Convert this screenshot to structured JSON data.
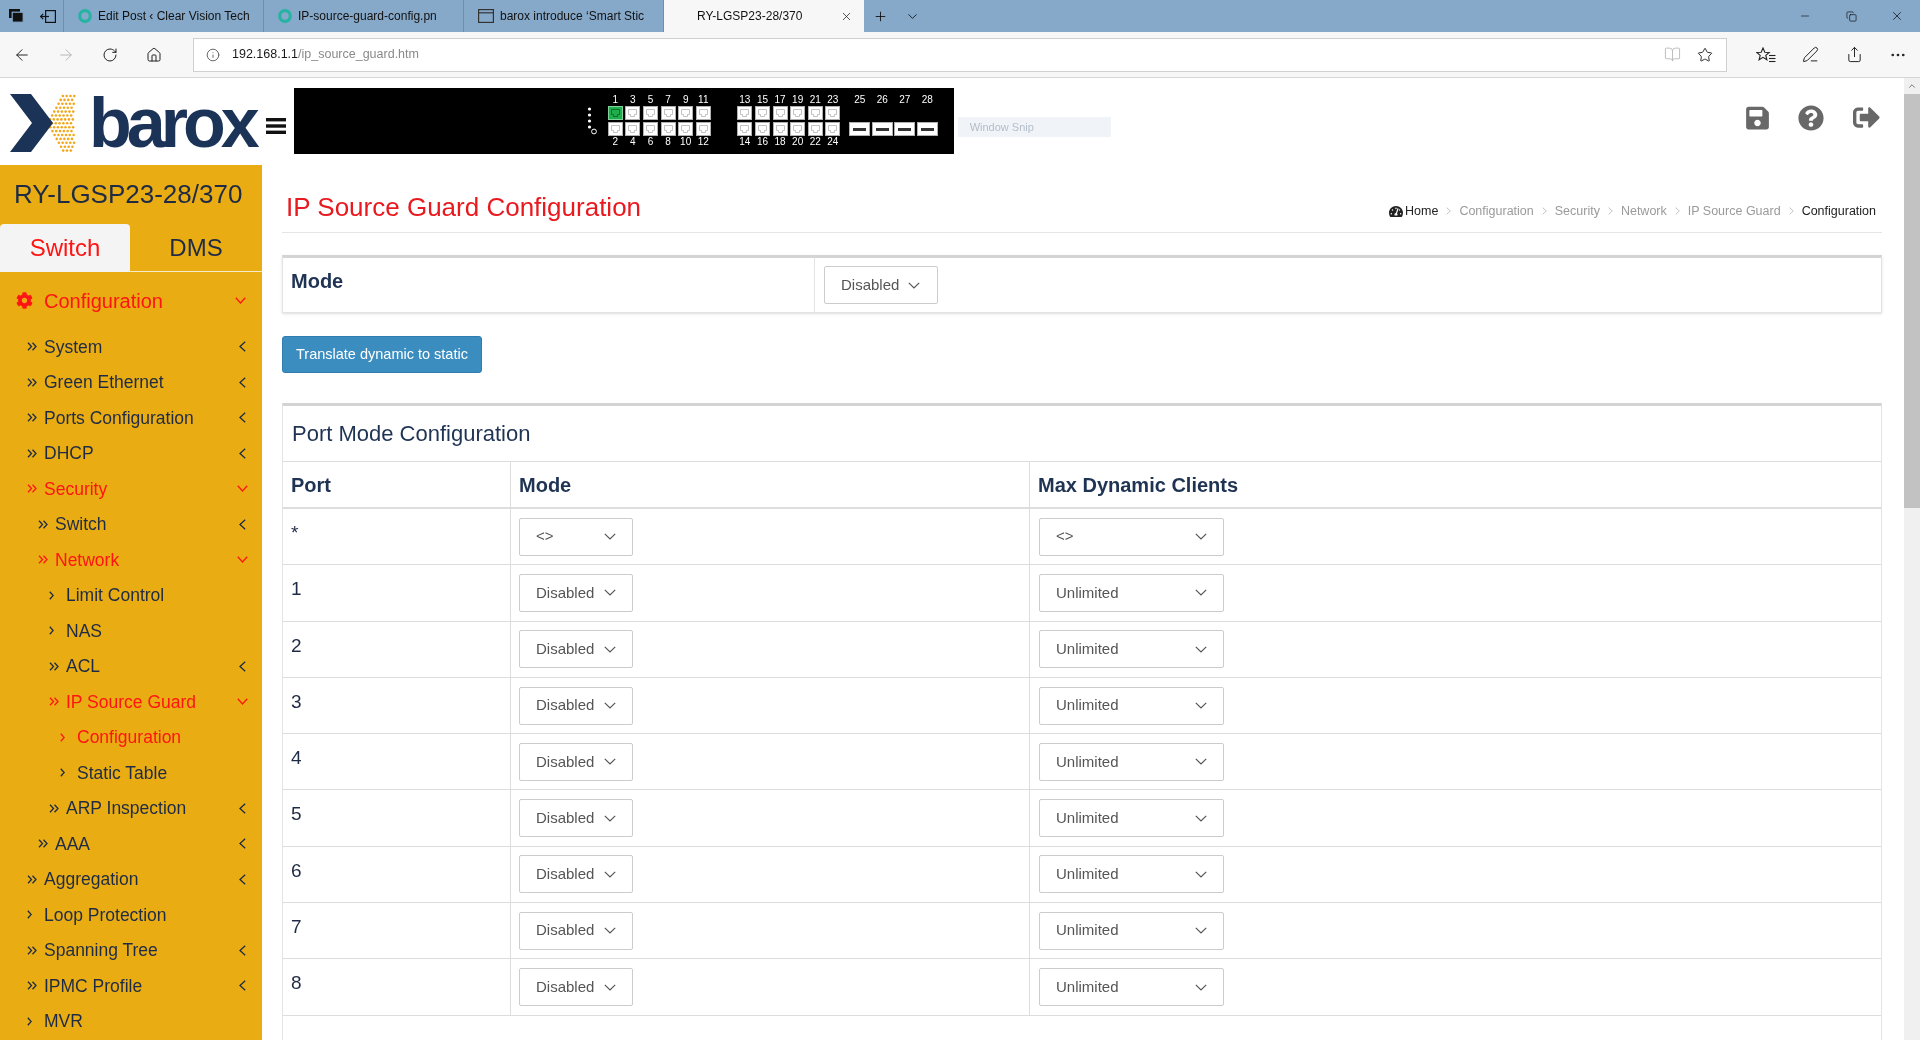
{
  "browser": {
    "tabs": [
      {
        "title": "Edit Post ‹ Clear Vision Tech",
        "kind": "site",
        "selected": false
      },
      {
        "title": "IP-source-guard-config.pn",
        "kind": "site",
        "selected": false
      },
      {
        "title": "barox introduce ‘Smart Stic",
        "kind": "window",
        "selected": false
      },
      {
        "title": "RY-LGSP23-28/370",
        "kind": "none",
        "selected": true
      }
    ],
    "address": {
      "host": "192.168.1.1",
      "path": "/ip_source_guard.htm"
    },
    "forward_disabled": true,
    "reading_view_disabled": true
  },
  "header": {
    "logo": "barox",
    "snip_label": "Window Snip"
  },
  "switch_panel": {
    "groups": [
      {
        "kind": "rj45",
        "ports": [
          {
            "label": "1",
            "up": true
          },
          {
            "label": "2",
            "up": false
          },
          {
            "label": "3",
            "up": false
          },
          {
            "label": "4",
            "up": false
          },
          {
            "label": "5",
            "up": false
          },
          {
            "label": "6",
            "up": false
          },
          {
            "label": "7",
            "up": false
          },
          {
            "label": "8",
            "up": false
          },
          {
            "label": "9",
            "up": false
          },
          {
            "label": "10",
            "up": false
          },
          {
            "label": "11",
            "up": false
          },
          {
            "label": "12",
            "up": false
          }
        ]
      },
      {
        "kind": "rj45",
        "ports": [
          {
            "label": "13",
            "up": false
          },
          {
            "label": "14",
            "up": false
          },
          {
            "label": "15",
            "up": false
          },
          {
            "label": "16",
            "up": false
          },
          {
            "label": "17",
            "up": false
          },
          {
            "label": "18",
            "up": false
          },
          {
            "label": "19",
            "up": false
          },
          {
            "label": "20",
            "up": false
          },
          {
            "label": "21",
            "up": false
          },
          {
            "label": "22",
            "up": false
          },
          {
            "label": "23",
            "up": false
          },
          {
            "label": "24",
            "up": false
          }
        ]
      },
      {
        "kind": "sfp",
        "ports": [
          {
            "label": "25",
            "up": false
          },
          {
            "label": "26",
            "up": false
          },
          {
            "label": "27",
            "up": false
          },
          {
            "label": "28",
            "up": false
          }
        ]
      }
    ]
  },
  "sidebar": {
    "model": "RY-LGSP23-28/370",
    "tabs": [
      {
        "label": "Switch",
        "selected": true
      },
      {
        "label": "DMS",
        "selected": false
      }
    ],
    "menu": [
      {
        "label": "Configuration",
        "kind": "section",
        "expanded": true,
        "active": true,
        "children": [
          {
            "label": "System",
            "kind": "group",
            "expanded": false,
            "active": false
          },
          {
            "label": "Green Ethernet",
            "kind": "group",
            "expanded": false,
            "active": false
          },
          {
            "label": "Ports Configuration",
            "kind": "group",
            "expanded": false,
            "active": false
          },
          {
            "label": "DHCP",
            "kind": "group",
            "expanded": false,
            "active": false
          },
          {
            "label": "Security",
            "kind": "group",
            "expanded": true,
            "active": true,
            "children": [
              {
                "label": "Switch",
                "kind": "group",
                "expanded": false,
                "active": false
              },
              {
                "label": "Network",
                "kind": "group",
                "expanded": true,
                "active": true,
                "children": [
                  {
                    "label": "Limit Control",
                    "kind": "link",
                    "active": false
                  },
                  {
                    "label": "NAS",
                    "kind": "link",
                    "active": false
                  },
                  {
                    "label": "ACL",
                    "kind": "group",
                    "expanded": false,
                    "active": false
                  },
                  {
                    "label": "IP Source Guard",
                    "kind": "group",
                    "expanded": true,
                    "active": true,
                    "children": [
                      {
                        "label": "Configuration",
                        "kind": "link",
                        "active": true
                      },
                      {
                        "label": "Static Table",
                        "kind": "link",
                        "active": false
                      }
                    ]
                  },
                  {
                    "label": "ARP Inspection",
                    "kind": "group",
                    "expanded": false,
                    "active": false
                  }
                ]
              },
              {
                "label": "AAA",
                "kind": "group",
                "expanded": false,
                "active": false
              }
            ]
          },
          {
            "label": "Aggregation",
            "kind": "group",
            "expanded": false,
            "active": false
          },
          {
            "label": "Loop Protection",
            "kind": "link",
            "active": false
          },
          {
            "label": "Spanning Tree",
            "kind": "group",
            "expanded": false,
            "active": false
          },
          {
            "label": "IPMC Profile",
            "kind": "group",
            "expanded": false,
            "active": false
          },
          {
            "label": "MVR",
            "kind": "link",
            "active": false
          }
        ]
      }
    ]
  },
  "page": {
    "title": "IP Source Guard Configuration",
    "breadcrumb": [
      {
        "label": "Home",
        "kind": "home"
      },
      {
        "label": "Configuration",
        "kind": "link"
      },
      {
        "label": "Security",
        "kind": "link"
      },
      {
        "label": "Network",
        "kind": "link"
      },
      {
        "label": "IP Source Guard",
        "kind": "link"
      },
      {
        "label": "Configuration",
        "kind": "current"
      }
    ]
  },
  "mode_panel": {
    "label": "Mode",
    "value": "Disabled"
  },
  "translate_button": "Translate dynamic to static",
  "port_mode": {
    "title": "Port Mode Configuration",
    "columns": [
      "Port",
      "Mode",
      "Max Dynamic Clients"
    ],
    "rows": [
      {
        "port": "*",
        "mode": "<>",
        "max_clients": "<>"
      },
      {
        "port": "1",
        "mode": "Disabled",
        "max_clients": "Unlimited"
      },
      {
        "port": "2",
        "mode": "Disabled",
        "max_clients": "Unlimited"
      },
      {
        "port": "3",
        "mode": "Disabled",
        "max_clients": "Unlimited"
      },
      {
        "port": "4",
        "mode": "Disabled",
        "max_clients": "Unlimited"
      },
      {
        "port": "5",
        "mode": "Disabled",
        "max_clients": "Unlimited"
      },
      {
        "port": "6",
        "mode": "Disabled",
        "max_clients": "Unlimited"
      },
      {
        "port": "7",
        "mode": "Disabled",
        "max_clients": "Unlimited"
      },
      {
        "port": "8",
        "mode": "Disabled",
        "max_clients": "Unlimited"
      }
    ]
  }
}
